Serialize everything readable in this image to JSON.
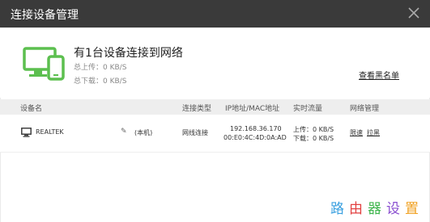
{
  "window": {
    "title": "连接设备管理"
  },
  "summary": {
    "title": "有1台设备连接到网络",
    "upload": "总上传：0 KB/S",
    "download": "总下载：0 KB/S",
    "blacklist_link": "查看黑名单"
  },
  "table": {
    "headers": {
      "device_name": "设备名",
      "conn_type": "连接类型",
      "ip_mac": "IP地址/MAC地址",
      "traffic": "实时流量",
      "net_mgmt": "网络管理"
    },
    "rows": [
      {
        "name": "REALTEK",
        "local_tag": "(本机)",
        "conn_type": "网线连接",
        "ip": "192.168.36.170",
        "mac": "00:E0:4C:4D:0A:AD",
        "up": "上传：0 KB/S",
        "down": "下载：0 KB/S",
        "limit_label": "限速",
        "block_label": "拉黑"
      }
    ]
  },
  "watermark": [
    "路",
    "由",
    "器",
    "设",
    "置"
  ],
  "colors": {
    "titlebar_bg": "#3a3a3a",
    "device_icon": "#5cbf4f",
    "header_bg": "#eeeeee"
  }
}
